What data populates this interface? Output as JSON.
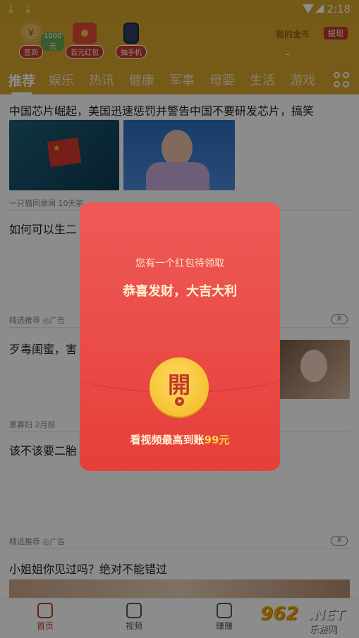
{
  "status_bar": {
    "time": "2:18",
    "download_icons": [
      "download-icon",
      "download-icon"
    ]
  },
  "header": {
    "rewards": [
      {
        "label": "签到",
        "badge": "1000元",
        "icon": "coin-icon"
      },
      {
        "label": "百元红包",
        "icon": "red-envelope-icon"
      },
      {
        "label": "抽手机",
        "icon": "phone-icon"
      }
    ],
    "gold_title": "我的金币",
    "gold_value": "-",
    "withdraw_label": "提现"
  },
  "tabs": [
    "推荐",
    "娱乐",
    "热讯",
    "健康",
    "军事",
    "母婴",
    "生活",
    "游戏"
  ],
  "feed": {
    "item1": {
      "title": "中国芯片崛起，美国迅速惩罚并警告中国不要研发芯片，搞笑",
      "meta": "一只猫同录闻  10天前"
    },
    "item2": {
      "title": "如何可以生二"
    },
    "ad1": {
      "meta": "精选推荐",
      "ad_label": "广告",
      "close": "X"
    },
    "item3": {
      "title": "歹毒闺蜜，害"
    },
    "item3_meta": {
      "meta": "黑寡妇  2月前"
    },
    "item4": {
      "title": "该不该要二胎"
    },
    "ad2": {
      "meta": "精选推荐",
      "ad_label": "广告",
      "close": "X"
    },
    "item5": {
      "title": "小姐姐你见过吗？绝对不能错过"
    }
  },
  "bottom_nav": [
    {
      "label": "首页",
      "icon": "home-icon"
    },
    {
      "label": "视频",
      "icon": "video-icon"
    },
    {
      "label": "赚赚",
      "icon": "earn-icon"
    }
  ],
  "watermark": {
    "number": "962",
    "suffix": ".NET",
    "site": "乐游网"
  },
  "modal": {
    "subtitle": "您有一个红包待领取",
    "headline": "恭喜发财，大吉大利",
    "open_char": "開",
    "footer_prefix": "看视频最高到账",
    "footer_amount": "99元"
  },
  "colors": {
    "header": "#d7a52d",
    "modal": "#e63f3a",
    "accent": "#c0392b",
    "gold": "#ffd23c"
  }
}
